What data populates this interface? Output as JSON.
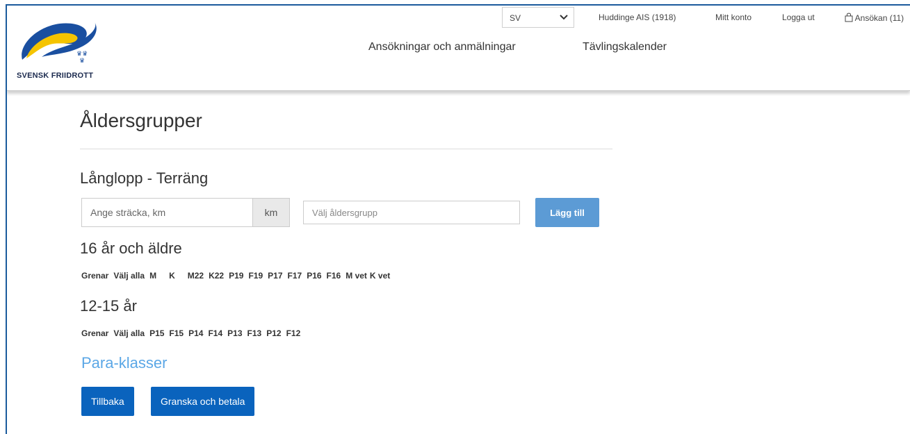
{
  "header": {
    "logo_text": "SVENSK FRIIDROTT",
    "language": "SV",
    "club": "Huddinge AIS (1918)",
    "my_account": "Mitt konto",
    "logout": "Logga ut",
    "cart": "Ansökan (11)",
    "nav": [
      "Ansökningar och anmälningar",
      "Tävlingskalender"
    ]
  },
  "page": {
    "title": "Åldersgrupper",
    "section": "Långlopp - Terräng",
    "distance_placeholder": "Ange sträcka, km",
    "distance_unit": "km",
    "age_placeholder": "Välj åldersgrupp",
    "add_button": "Lägg till"
  },
  "groups": [
    {
      "title": "16 år och äldre",
      "label": "Grenar",
      "select_all": "Välj alla",
      "items": [
        "M",
        "K",
        "M22",
        "K22",
        "P19",
        "F19",
        "P17",
        "F17",
        "P16",
        "F16",
        "M vet",
        "K vet"
      ]
    },
    {
      "title": "12-15 år",
      "label": "Grenar",
      "select_all": "Välj alla",
      "items": [
        "P15",
        "F15",
        "P14",
        "F14",
        "P13",
        "F13",
        "P12",
        "F12"
      ]
    }
  ],
  "para_link": "Para-klasser",
  "buttons": {
    "back": "Tillbaka",
    "review_pay": "Granska och betala"
  },
  "colors": {
    "primary": "#0a63bd",
    "light_button": "#5c9bd5",
    "link": "#5ba7e6",
    "logo_blue": "#1a4fa0",
    "logo_yellow": "#f5c400"
  }
}
